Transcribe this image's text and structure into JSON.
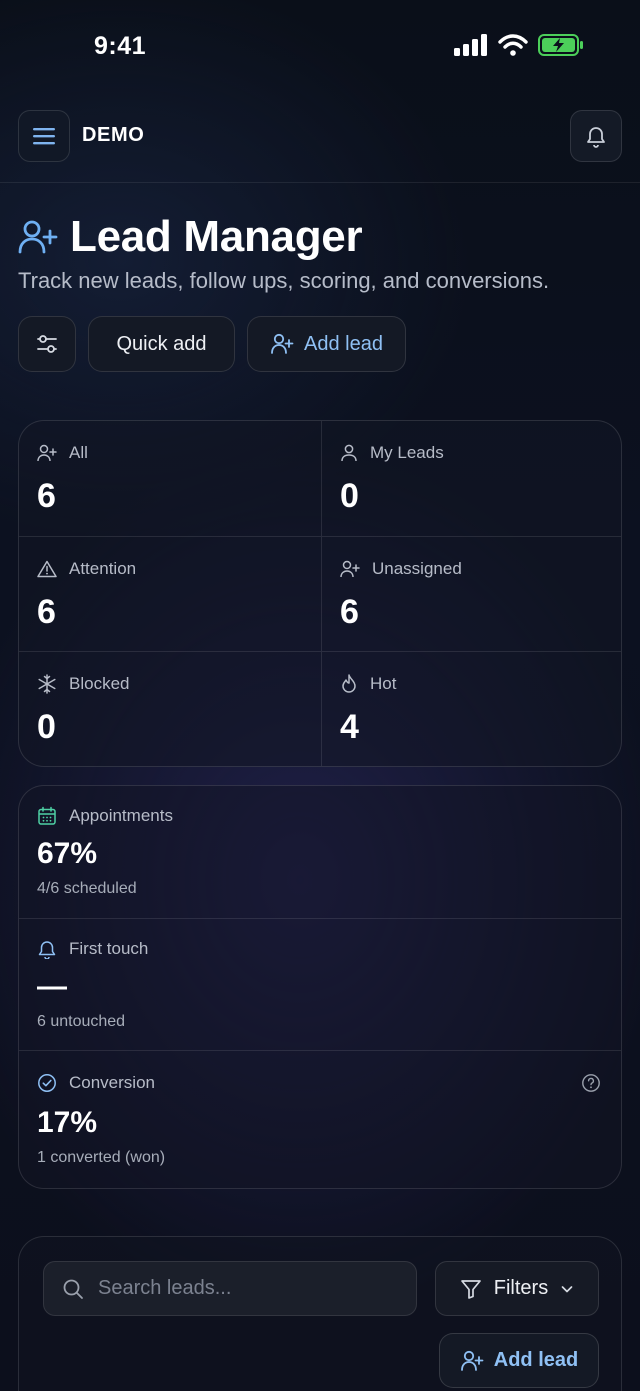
{
  "status_bar": {
    "time": "9:41"
  },
  "nav": {
    "brand": "DEMO"
  },
  "header": {
    "title": "Lead Manager",
    "subtitle": "Track new leads, follow ups, scoring, and conversions."
  },
  "actions": {
    "quick_add_label": "Quick add",
    "add_lead_label": "Add lead"
  },
  "stats": [
    {
      "icon": "user-plus-icon",
      "label": "All",
      "value": "6"
    },
    {
      "icon": "user-icon",
      "label": "My Leads",
      "value": "0"
    },
    {
      "icon": "warning-icon",
      "label": "Attention",
      "value": "6"
    },
    {
      "icon": "user-plus-icon",
      "label": "Unassigned",
      "value": "6"
    },
    {
      "icon": "snowflake-icon",
      "label": "Blocked",
      "value": "0"
    },
    {
      "icon": "flame-icon",
      "label": "Hot",
      "value": "4"
    }
  ],
  "metrics": [
    {
      "icon": "calendar-icon",
      "label": "Appointments",
      "value": "67%",
      "sub": "4/6 scheduled"
    },
    {
      "icon": "bell-icon",
      "label": "First touch",
      "value": "—",
      "sub": "6 untouched"
    },
    {
      "icon": "check-circle-icon",
      "label": "Conversion",
      "value": "17%",
      "sub": "1 converted (won)"
    }
  ],
  "search": {
    "placeholder": "Search leads...",
    "value": ""
  },
  "filters": {
    "label": "Filters"
  },
  "panel": {
    "add_lead_label": "Add lead"
  },
  "colors": {
    "accent": "#8fc0f4",
    "calendar": "#4fd1a5",
    "background": "#0b101c"
  }
}
